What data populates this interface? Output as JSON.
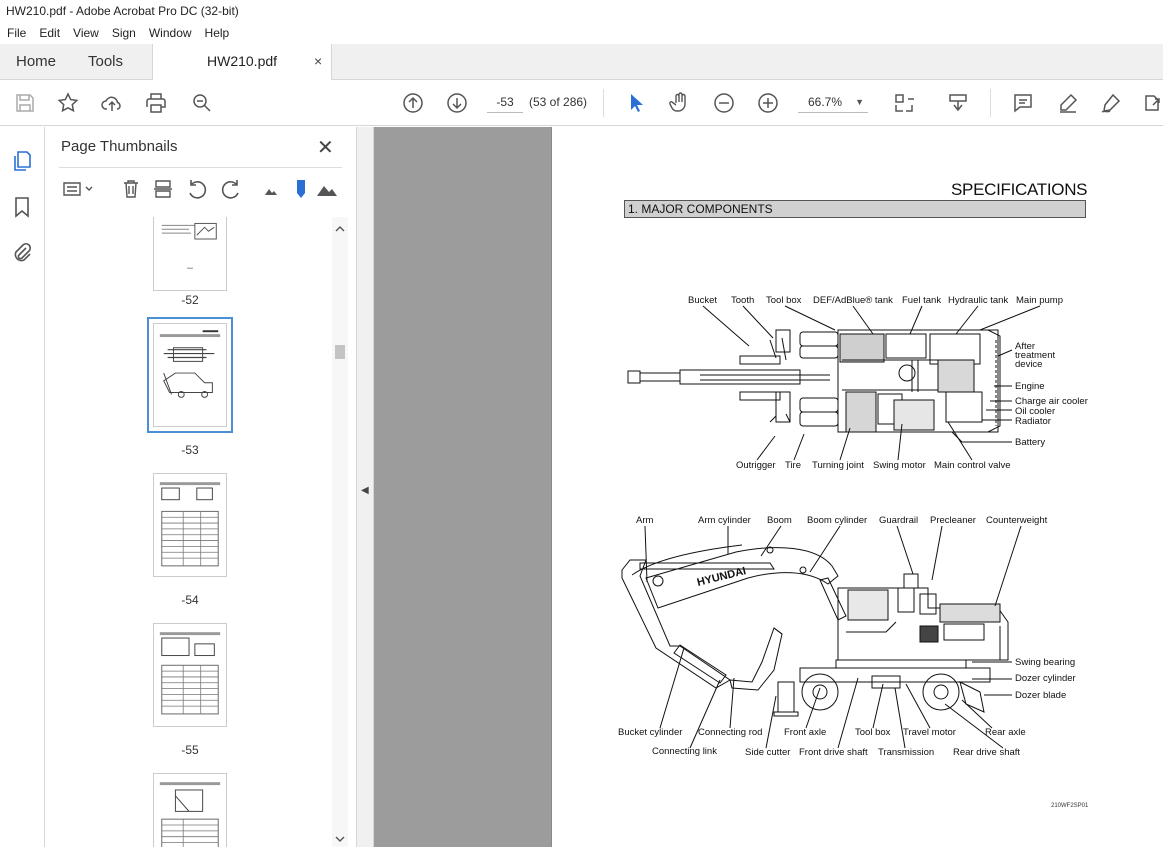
{
  "window": {
    "title": "HW210.pdf - Adobe Acrobat Pro DC (32-bit)"
  },
  "menu": [
    "File",
    "Edit",
    "View",
    "Sign",
    "Window",
    "Help"
  ],
  "tabs": {
    "home": "Home",
    "tools": "Tools",
    "document": "HW210.pdf",
    "close": "×"
  },
  "toolbar": {
    "page_value": "-53",
    "page_count": "(53 of 286)",
    "zoom": "66.7%"
  },
  "panel": {
    "title": "Page Thumbnails",
    "close": "✕",
    "thumbnails": [
      {
        "label": "-52"
      },
      {
        "label": "-53",
        "selected": true
      },
      {
        "label": "-54"
      },
      {
        "label": "-55"
      }
    ]
  },
  "page": {
    "heading": "SPECIFICATIONS",
    "section": "1. MAJOR COMPONENTS",
    "top_view_labels": {
      "bucket": "Bucket",
      "tooth": "Tooth",
      "tool_box": "Tool box",
      "def_tank": "DEF/AdBlue® tank",
      "fuel_tank": "Fuel tank",
      "hydraulic_tank": "Hydraulic tank",
      "main_pump": "Main pump",
      "after_treatment_1": "After",
      "after_treatment_2": "treatment",
      "after_treatment_3": "device",
      "engine": "Engine",
      "charge_air_cooler": "Charge air cooler",
      "oil_cooler": "Oil cooler",
      "radiator": "Radiator",
      "battery": "Battery",
      "outrigger": "Outrigger",
      "tire": "Tire",
      "turning_joint": "Turning joint",
      "swing_motor": "Swing motor",
      "main_control_valve": "Main control valve"
    },
    "side_view_labels": {
      "arm": "Arm",
      "arm_cylinder": "Arm cylinder",
      "boom": "Boom",
      "boom_cylinder": "Boom cylinder",
      "guardrail": "Guardrail",
      "precleaner": "Precleaner",
      "counterweight": "Counterweight",
      "swing_bearing": "Swing bearing",
      "dozer_cylinder": "Dozer cylinder",
      "dozer_blade": "Dozer blade",
      "bucket_cylinder": "Bucket cylinder",
      "connecting_link": "Connecting link",
      "connecting_rod": "Connecting rod",
      "side_cutter": "Side cutter",
      "front_axle": "Front axle",
      "front_drive_shaft": "Front drive shaft",
      "tool_box": "Tool box",
      "transmission": "Transmission",
      "travel_motor": "Travel motor",
      "rear_axle": "Rear axle",
      "rear_drive_shaft": "Rear drive shaft",
      "brand": "HYUNDAI"
    },
    "figure_id": "210WF2SP01"
  }
}
